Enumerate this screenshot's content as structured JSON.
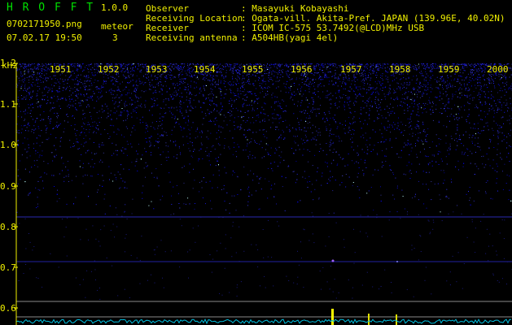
{
  "app": {
    "name": "H R O F F T",
    "version": "1.0.0"
  },
  "file": {
    "name": "0702171950.png",
    "datetime": "07.02.17 19:50"
  },
  "meteor": {
    "label": "meteor",
    "count": "3"
  },
  "info": {
    "labels": [
      "Observer",
      "Receiving Location",
      "Receiver",
      "Receiving antenna"
    ],
    "values": [
      ": Masayuki Kobayashi",
      ": Ogata-vill. Akita-Pref. JAPAN (139.96E, 40.02N)",
      ": ICOM IC-575 53.7492(@LCD)MHz USB",
      ": A504HB(yagi 4el)"
    ]
  },
  "axis": {
    "freq_unit": "kHz",
    "freq_ticks": [
      "1.2",
      "1.1",
      "1.0",
      "0.9",
      "0.8",
      "0.7",
      "0.6"
    ],
    "time_ticks": [
      "1951",
      "1952",
      "1953",
      "1954",
      "1955",
      "1956",
      "1957",
      "1958",
      "1959",
      "2000"
    ]
  },
  "colors": {
    "header_green": "#00e000",
    "label_yellow": "#f0f000",
    "noise_blue": "#2020d0",
    "meteor_yellow": "#ffff00",
    "trace_cyan": "#00c0e0"
  }
}
